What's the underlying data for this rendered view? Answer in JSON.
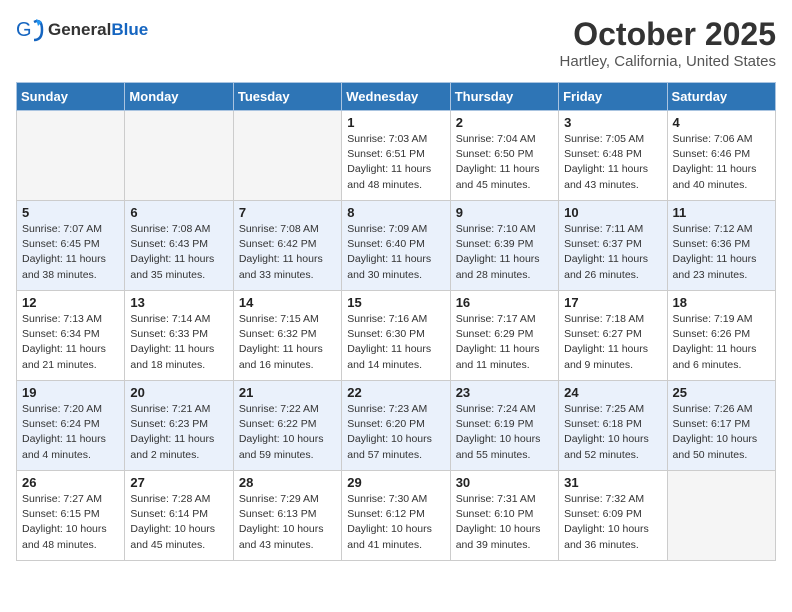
{
  "header": {
    "logo_general": "General",
    "logo_blue": "Blue",
    "month": "October 2025",
    "location": "Hartley, California, United States"
  },
  "weekdays": [
    "Sunday",
    "Monday",
    "Tuesday",
    "Wednesday",
    "Thursday",
    "Friday",
    "Saturday"
  ],
  "weeks": [
    [
      {
        "day": "",
        "info": ""
      },
      {
        "day": "",
        "info": ""
      },
      {
        "day": "",
        "info": ""
      },
      {
        "day": "1",
        "info": "Sunrise: 7:03 AM\nSunset: 6:51 PM\nDaylight: 11 hours\nand 48 minutes."
      },
      {
        "day": "2",
        "info": "Sunrise: 7:04 AM\nSunset: 6:50 PM\nDaylight: 11 hours\nand 45 minutes."
      },
      {
        "day": "3",
        "info": "Sunrise: 7:05 AM\nSunset: 6:48 PM\nDaylight: 11 hours\nand 43 minutes."
      },
      {
        "day": "4",
        "info": "Sunrise: 7:06 AM\nSunset: 6:46 PM\nDaylight: 11 hours\nand 40 minutes."
      }
    ],
    [
      {
        "day": "5",
        "info": "Sunrise: 7:07 AM\nSunset: 6:45 PM\nDaylight: 11 hours\nand 38 minutes."
      },
      {
        "day": "6",
        "info": "Sunrise: 7:08 AM\nSunset: 6:43 PM\nDaylight: 11 hours\nand 35 minutes."
      },
      {
        "day": "7",
        "info": "Sunrise: 7:08 AM\nSunset: 6:42 PM\nDaylight: 11 hours\nand 33 minutes."
      },
      {
        "day": "8",
        "info": "Sunrise: 7:09 AM\nSunset: 6:40 PM\nDaylight: 11 hours\nand 30 minutes."
      },
      {
        "day": "9",
        "info": "Sunrise: 7:10 AM\nSunset: 6:39 PM\nDaylight: 11 hours\nand 28 minutes."
      },
      {
        "day": "10",
        "info": "Sunrise: 7:11 AM\nSunset: 6:37 PM\nDaylight: 11 hours\nand 26 minutes."
      },
      {
        "day": "11",
        "info": "Sunrise: 7:12 AM\nSunset: 6:36 PM\nDaylight: 11 hours\nand 23 minutes."
      }
    ],
    [
      {
        "day": "12",
        "info": "Sunrise: 7:13 AM\nSunset: 6:34 PM\nDaylight: 11 hours\nand 21 minutes."
      },
      {
        "day": "13",
        "info": "Sunrise: 7:14 AM\nSunset: 6:33 PM\nDaylight: 11 hours\nand 18 minutes."
      },
      {
        "day": "14",
        "info": "Sunrise: 7:15 AM\nSunset: 6:32 PM\nDaylight: 11 hours\nand 16 minutes."
      },
      {
        "day": "15",
        "info": "Sunrise: 7:16 AM\nSunset: 6:30 PM\nDaylight: 11 hours\nand 14 minutes."
      },
      {
        "day": "16",
        "info": "Sunrise: 7:17 AM\nSunset: 6:29 PM\nDaylight: 11 hours\nand 11 minutes."
      },
      {
        "day": "17",
        "info": "Sunrise: 7:18 AM\nSunset: 6:27 PM\nDaylight: 11 hours\nand 9 minutes."
      },
      {
        "day": "18",
        "info": "Sunrise: 7:19 AM\nSunset: 6:26 PM\nDaylight: 11 hours\nand 6 minutes."
      }
    ],
    [
      {
        "day": "19",
        "info": "Sunrise: 7:20 AM\nSunset: 6:24 PM\nDaylight: 11 hours\nand 4 minutes."
      },
      {
        "day": "20",
        "info": "Sunrise: 7:21 AM\nSunset: 6:23 PM\nDaylight: 11 hours\nand 2 minutes."
      },
      {
        "day": "21",
        "info": "Sunrise: 7:22 AM\nSunset: 6:22 PM\nDaylight: 10 hours\nand 59 minutes."
      },
      {
        "day": "22",
        "info": "Sunrise: 7:23 AM\nSunset: 6:20 PM\nDaylight: 10 hours\nand 57 minutes."
      },
      {
        "day": "23",
        "info": "Sunrise: 7:24 AM\nSunset: 6:19 PM\nDaylight: 10 hours\nand 55 minutes."
      },
      {
        "day": "24",
        "info": "Sunrise: 7:25 AM\nSunset: 6:18 PM\nDaylight: 10 hours\nand 52 minutes."
      },
      {
        "day": "25",
        "info": "Sunrise: 7:26 AM\nSunset: 6:17 PM\nDaylight: 10 hours\nand 50 minutes."
      }
    ],
    [
      {
        "day": "26",
        "info": "Sunrise: 7:27 AM\nSunset: 6:15 PM\nDaylight: 10 hours\nand 48 minutes."
      },
      {
        "day": "27",
        "info": "Sunrise: 7:28 AM\nSunset: 6:14 PM\nDaylight: 10 hours\nand 45 minutes."
      },
      {
        "day": "28",
        "info": "Sunrise: 7:29 AM\nSunset: 6:13 PM\nDaylight: 10 hours\nand 43 minutes."
      },
      {
        "day": "29",
        "info": "Sunrise: 7:30 AM\nSunset: 6:12 PM\nDaylight: 10 hours\nand 41 minutes."
      },
      {
        "day": "30",
        "info": "Sunrise: 7:31 AM\nSunset: 6:10 PM\nDaylight: 10 hours\nand 39 minutes."
      },
      {
        "day": "31",
        "info": "Sunrise: 7:32 AM\nSunset: 6:09 PM\nDaylight: 10 hours\nand 36 minutes."
      },
      {
        "day": "",
        "info": ""
      }
    ]
  ]
}
